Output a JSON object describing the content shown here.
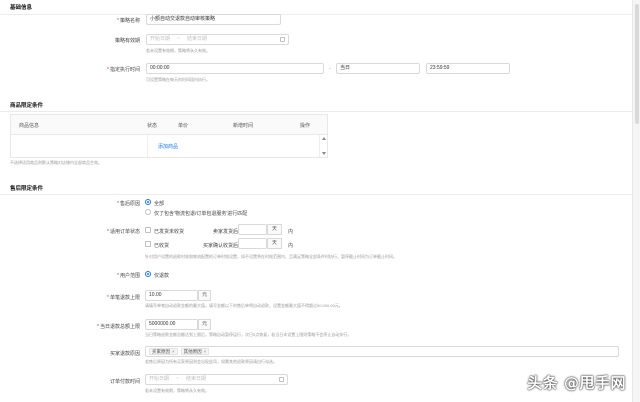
{
  "basic": {
    "title": "基础信息",
    "name_label": "策略名称",
    "name_value": "小额自动交退款自动审核策略",
    "validity_label": "策略有效期",
    "validity_start": "开始日期",
    "validity_sep": "~",
    "validity_end": "结束日期",
    "validity_help": "若未设置有效期，策略将永久有效。",
    "exec_label": "指定执行时间",
    "exec_start": "00:00:00",
    "exec_dash": "-",
    "exec_day": "当日",
    "exec_end": "23:59:59",
    "exec_help": "可设置策略在每天的时间段内执行。"
  },
  "product": {
    "title": "商品限定条件",
    "columns": [
      "商品信息",
      "状态",
      "单价",
      "新增时间",
      "操作"
    ],
    "add_label": "添加商品",
    "help": "不选择适用商品则默认策略对店铺内全部商品生效。"
  },
  "aftersale": {
    "title": "售后限定条件",
    "type_label": "售后原因",
    "type_opt1": "全部",
    "type_opt2": "仅了包含'物流包退/订单包退服务'进行匹配",
    "status_label": "适用订单状态",
    "chk1": "已发货未收货",
    "ship_label": "卖家发货后",
    "chk2": "已收货",
    "confirm_label": "买家确认收货后",
    "day_unit": "天",
    "within": "内",
    "status_help": "针对用户设置的退款时效和物流配置的订单时效设置，如不设置将在时效范围内，且满足策略全部条件时执行，暂停截止时间为订单截止时间。",
    "buyer_label": "用户范围",
    "buyer_opt": "仅退款",
    "single_label": "单笔退款上限",
    "single_value": "10.00",
    "single_unit": "元",
    "single_help": "请填写单笔自动退款金额的最大值，填写金额以下的售后单将自动退款，设置金额最大值不得超过50,000.00元。",
    "total_label": "当日退款总额上限",
    "total_value": "5000000.00",
    "total_unit": "元",
    "total_help": "当日策略退款金额总额达到上限后，策略自动暂停运行，次日0点恢复，若当日未设置上限则策略不会停止自动执行。",
    "reason_label": "买家退款原因",
    "reason_tags": [
      "买家原因",
      "其他原因"
    ],
    "reason_help": "若售后原因为所有买家原因则会出现此项，如需其他退款原因请自行勾选。",
    "paytime_label": "订单付款时间",
    "paytime_start": "开始日期",
    "paytime_sep": "~",
    "paytime_end": "结束日期",
    "paytime_help": "若未设置有效期，策略将永久有效。"
  },
  "watermark": "头条 @甩手网"
}
